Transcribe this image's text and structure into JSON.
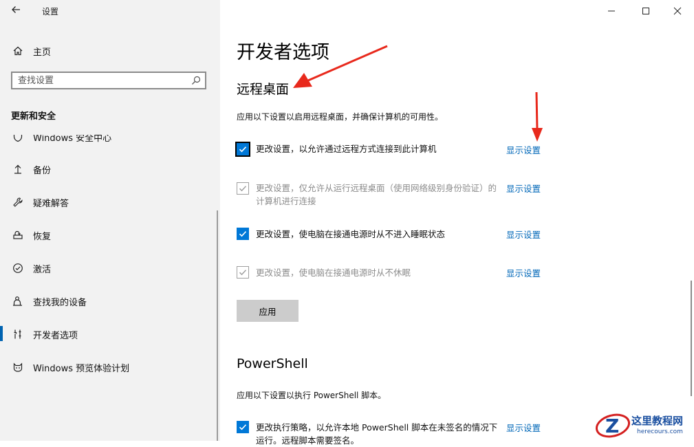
{
  "window": {
    "app_title": "设置"
  },
  "sidebar": {
    "home_label": "主页",
    "search_placeholder": "查找设置",
    "section_title": "更新和安全",
    "partial_item_label": "Windows 安全中心",
    "items": [
      {
        "label": "备份",
        "icon": "backup-icon"
      },
      {
        "label": "疑难解答",
        "icon": "wrench-icon"
      },
      {
        "label": "恢复",
        "icon": "recovery-icon"
      },
      {
        "label": "激活",
        "icon": "activation-icon"
      },
      {
        "label": "查找我的设备",
        "icon": "person-location-icon"
      },
      {
        "label": "开发者选项",
        "icon": "developer-tools-icon",
        "active": true
      },
      {
        "label": "Windows 预览体验计划",
        "icon": "insider-cat-icon"
      }
    ],
    "accent_color": "#0063b1"
  },
  "main": {
    "page_title": "开发者选项",
    "remote_desktop": {
      "heading": "远程桌面",
      "description": "应用以下设置以启用远程桌面，并确保计算机的可用性。",
      "options": [
        {
          "text": "更改设置，以允许通过远程方式连接到此计算机",
          "checked": true,
          "enabled": true,
          "link": "显示设置"
        },
        {
          "text": "更改设置，仅允许从运行远程桌面（使用网络级别身份验证）的计算机进行连接",
          "checked": true,
          "enabled": false,
          "link": "显示设置"
        },
        {
          "text": "更改设置，使电脑在接通电源时从不进入睡眠状态",
          "checked": true,
          "enabled": true,
          "link": "显示设置"
        },
        {
          "text": "更改设置，使电脑在接通电源时从不休眠",
          "checked": true,
          "enabled": false,
          "link": "显示设置"
        }
      ],
      "apply_label": "应用"
    },
    "powershell": {
      "heading": "PowerShell",
      "description": "应用以下设置以执行 PowerShell 脚本。",
      "option": {
        "text": "更改执行策略，以允许本地 PowerShell 脚本在未签名的情况下运行。远程脚本需要签名。",
        "checked": true,
        "link": "显示设置"
      }
    },
    "link_color": "#0067b8",
    "checkbox_color": "#0078d7"
  },
  "watermark": {
    "title": "这里教程网",
    "url": "herecours.com"
  },
  "annotations": {
    "arrow_color": "#e8291c"
  }
}
